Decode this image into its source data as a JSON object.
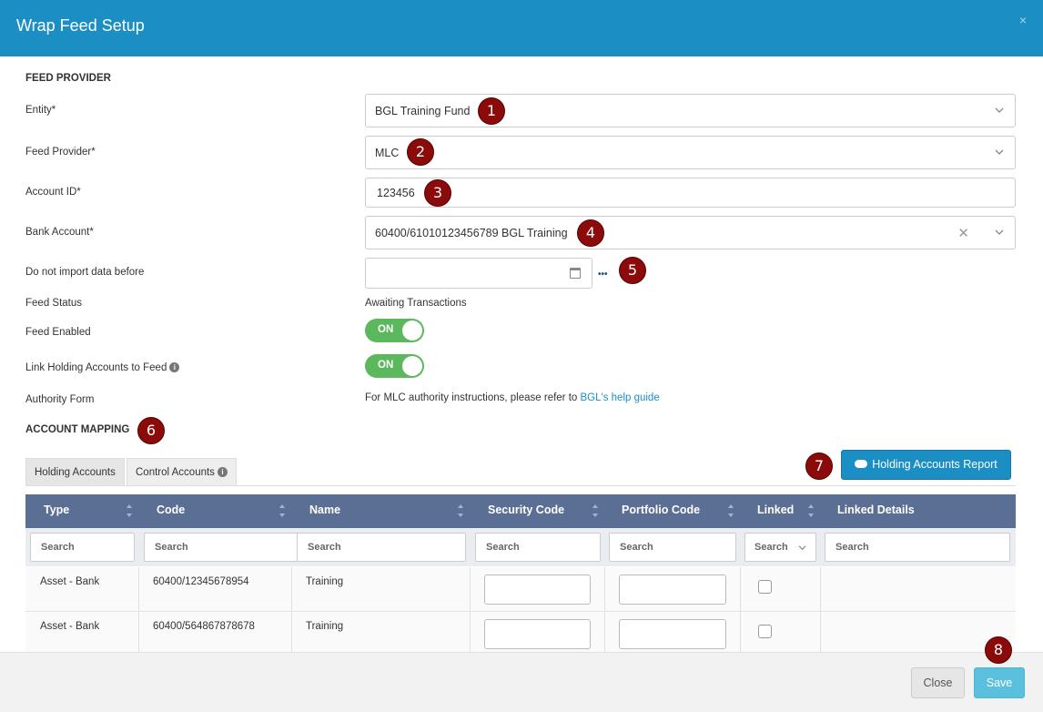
{
  "dialog": {
    "title": "Wrap Feed Setup",
    "close_symbol": "×"
  },
  "feed_provider": {
    "section_title": "FEED PROVIDER",
    "entity": {
      "label": "Entity*",
      "value": "BGL Training Fund"
    },
    "provider": {
      "label": "Feed Provider*",
      "value": "MLC"
    },
    "account_id": {
      "label": "Account ID*",
      "value": "123456"
    },
    "bank_account": {
      "label": "Bank Account*",
      "value": "60400/61010123456789 BGL Training",
      "clear_symbol": "✕"
    },
    "import_before": {
      "label": "Do not import data before",
      "value": "",
      "more_symbol": "•••"
    },
    "feed_status": {
      "label": "Feed Status",
      "value": "Awaiting Transactions"
    },
    "feed_enabled": {
      "label": "Feed Enabled",
      "state": "ON"
    },
    "link_holding": {
      "label": "Link Holding Accounts to Feed",
      "state": "ON"
    },
    "authority_form": {
      "label": "Authority Form",
      "text": "For MLC authority instructions, please refer to ",
      "link": "BGL's help guide"
    }
  },
  "account_mapping": {
    "section_title": "ACCOUNT MAPPING",
    "tabs": [
      {
        "label": "Holding Accounts"
      },
      {
        "label": "Control Accounts"
      }
    ],
    "report_button": "Holding Accounts Report",
    "columns": [
      "Type",
      "Code",
      "Name",
      "Security Code",
      "Portfolio Code",
      "Linked",
      "Linked Details"
    ],
    "filter_placeholder": "Search",
    "rows": [
      {
        "type": "Asset - Bank",
        "code": "60400/12345678954",
        "name": "Training",
        "security_code": "",
        "portfolio_code": "",
        "linked": false
      },
      {
        "type": "Asset - Bank",
        "code": "60400/564867878678",
        "name": "Training",
        "security_code": "",
        "portfolio_code": "",
        "linked": false
      }
    ]
  },
  "badges": [
    "1",
    "2",
    "3",
    "4",
    "5",
    "6",
    "7",
    "8"
  ],
  "footer": {
    "close_label": "Close",
    "save_label": "Save"
  },
  "colors": {
    "header": "#1b8fc4",
    "toggle_on": "#5cb85c",
    "grid_header": "#5b6f94",
    "badge": "#8b0a0a",
    "save": "#5bc0de"
  }
}
